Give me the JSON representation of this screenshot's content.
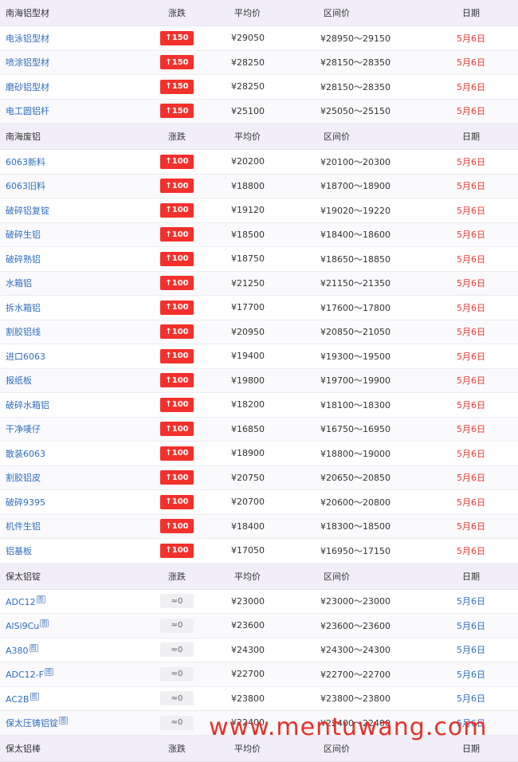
{
  "colors": {
    "up": "#f2312c",
    "link": "#2f6dbd",
    "date_red": "#e53b36",
    "header_bg": "#f1eef9"
  },
  "sections": [
    {
      "header": [
        "南海铝型材",
        "涨跌",
        "平均价",
        "区间价",
        "日期"
      ],
      "rows": [
        {
          "name": "电泳铝型材",
          "change": "↑150",
          "avg": "¥29050",
          "range": "¥28950～29150",
          "date": "5月6日"
        },
        {
          "name": "喷涂铝型材",
          "change": "↑150",
          "avg": "¥28250",
          "range": "¥28150～28350",
          "date": "5月6日"
        },
        {
          "name": "磨砂铝型材",
          "change": "↑150",
          "avg": "¥28250",
          "range": "¥28150～28350",
          "date": "5月6日"
        },
        {
          "name": "电工圆铝杆",
          "change": "↑150",
          "avg": "¥25100",
          "range": "¥25050～25150",
          "date": "5月6日"
        }
      ]
    },
    {
      "header": [
        "南海废铝",
        "涨跌",
        "平均价",
        "区间价",
        "日期"
      ],
      "rows": [
        {
          "name": "6063新料",
          "change": "↑100",
          "avg": "¥20200",
          "range": "¥20100～20300",
          "date": "5月6日"
        },
        {
          "name": "6063旧料",
          "change": "↑100",
          "avg": "¥18800",
          "range": "¥18700～18900",
          "date": "5月6日"
        },
        {
          "name": "破碎铝复锭",
          "change": "↑100",
          "avg": "¥19120",
          "range": "¥19020～19220",
          "date": "5月6日"
        },
        {
          "name": "破碎生铝",
          "change": "↑100",
          "avg": "¥18500",
          "range": "¥18400～18600",
          "date": "5月6日"
        },
        {
          "name": "破碎熟铝",
          "change": "↑100",
          "avg": "¥18750",
          "range": "¥18650～18850",
          "date": "5月6日"
        },
        {
          "name": "水箱铝",
          "change": "↑100",
          "avg": "¥21250",
          "range": "¥21150～21350",
          "date": "5月6日"
        },
        {
          "name": "拆水箱铝",
          "change": "↑100",
          "avg": "¥17700",
          "range": "¥17600～17800",
          "date": "5月6日"
        },
        {
          "name": "割胶铝线",
          "change": "↑100",
          "avg": "¥20950",
          "range": "¥20850～21050",
          "date": "5月6日"
        },
        {
          "name": "进口6063",
          "change": "↑100",
          "avg": "¥19400",
          "range": "¥19300～19500",
          "date": "5月6日"
        },
        {
          "name": "报纸板",
          "change": "↑100",
          "avg": "¥19800",
          "range": "¥19700～19900",
          "date": "5月6日"
        },
        {
          "name": "破碎水箱铝",
          "change": "↑100",
          "avg": "¥18200",
          "range": "¥18100～18300",
          "date": "5月6日"
        },
        {
          "name": "干净唛仔",
          "change": "↑100",
          "avg": "¥16850",
          "range": "¥16750～16950",
          "date": "5月6日"
        },
        {
          "name": "散装6063",
          "change": "↑100",
          "avg": "¥18900",
          "range": "¥18800～19000",
          "date": "5月6日"
        },
        {
          "name": "割胶铝皮",
          "change": "↑100",
          "avg": "¥20750",
          "range": "¥20650～20850",
          "date": "5月6日"
        },
        {
          "name": "破碎9395",
          "change": "↑100",
          "avg": "¥20700",
          "range": "¥20600～20800",
          "date": "5月6日"
        },
        {
          "name": "机件生铝",
          "change": "↑100",
          "avg": "¥18400",
          "range": "¥18300～18500",
          "date": "5月6日"
        },
        {
          "name": "铝基板",
          "change": "↑100",
          "avg": "¥17050",
          "range": "¥16950～17150",
          "date": "5月6日"
        }
      ]
    },
    {
      "header": [
        "保太铝锭",
        "涨跌",
        "平均价",
        "区间价",
        "日期"
      ],
      "rows": [
        {
          "name": "ADC12",
          "tag": "图",
          "change": "≈0",
          "avg": "¥23000",
          "range": "¥23000～23000",
          "date": "5月6日"
        },
        {
          "name": "AlSi9Cu",
          "tag": "图",
          "change": "≈0",
          "avg": "¥23600",
          "range": "¥23600～23600",
          "date": "5月6日"
        },
        {
          "name": "A380",
          "tag": "图",
          "change": "≈0",
          "avg": "¥24300",
          "range": "¥24300～24300",
          "date": "5月6日"
        },
        {
          "name": "ADC12-F",
          "tag": "图",
          "change": "≈0",
          "avg": "¥22700",
          "range": "¥22700～22700",
          "date": "5月6日"
        },
        {
          "name": "AC2B",
          "tag": "图",
          "change": "≈0",
          "avg": "¥23800",
          "range": "¥23800～23800",
          "date": "5月6日"
        },
        {
          "name": "保太压铸铝锭",
          "tag": "图",
          "change": "≈0",
          "avg": "¥22400",
          "range": "¥22400～22400",
          "date": "5月6日"
        }
      ]
    },
    {
      "header": [
        "保太铝棒",
        "涨跌",
        "平均价",
        "区间价",
        "日期"
      ],
      "rows": []
    }
  ],
  "watermark": "www.mentuwang.com"
}
